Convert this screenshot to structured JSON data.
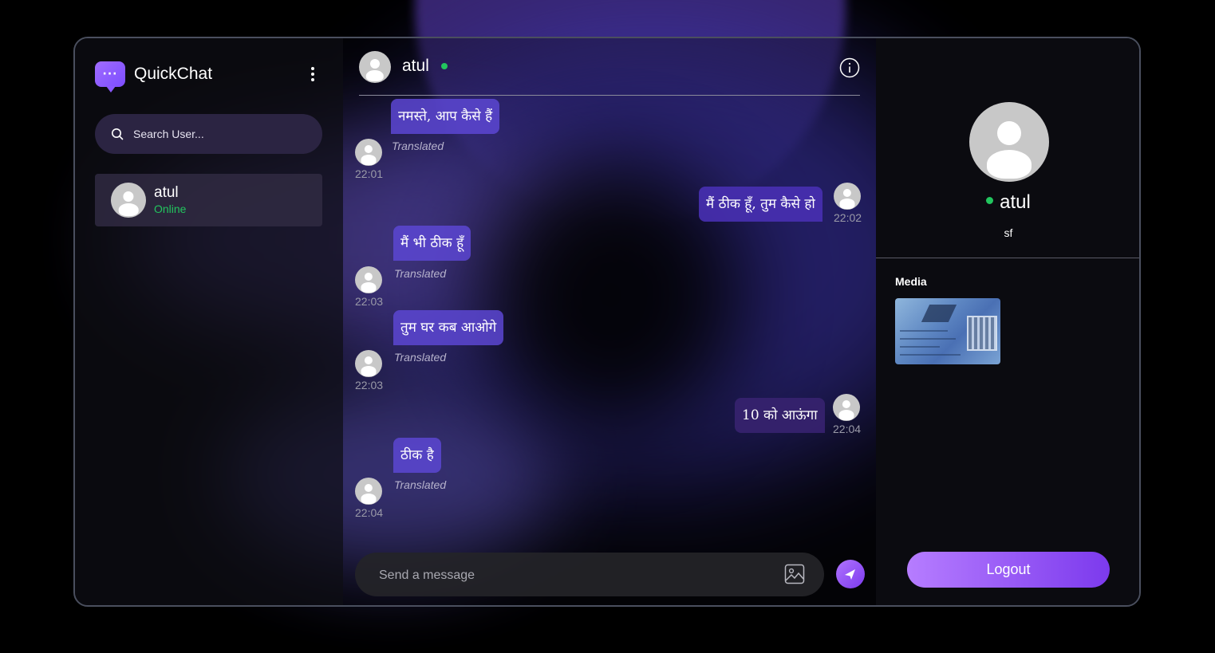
{
  "app": {
    "name": "QuickChat",
    "logo_glyph": "···"
  },
  "sidebar": {
    "search_placeholder": "Search User...",
    "users": [
      {
        "name": "atul",
        "status": "Online"
      }
    ]
  },
  "chat": {
    "contact_name": "atul",
    "messages": [
      {
        "direction": "in",
        "text": "नमस्ते, आप कैसे हैं",
        "translated_label": "Translated",
        "time": "22:01"
      },
      {
        "direction": "out",
        "text": "मैं ठीक हूँ, तुम कैसे हो",
        "time": "22:02"
      },
      {
        "direction": "in",
        "text": "मैं भी ठीक हूँ",
        "translated_label": "Translated",
        "time": "22:03"
      },
      {
        "direction": "in",
        "text": "तुम घर कब आओगे",
        "translated_label": "Translated",
        "time": "22:03"
      },
      {
        "direction": "out",
        "text": "10 को आऊंगा",
        "time": "22:04"
      },
      {
        "direction": "in",
        "text": "ठीक है",
        "translated_label": "Translated",
        "time": "22:04"
      }
    ],
    "composer_placeholder": "Send a message"
  },
  "profile": {
    "name": "atul",
    "bio": "sf",
    "media_label": "Media",
    "logout_label": "Logout"
  },
  "colors": {
    "accent": "#8b5cf6",
    "online": "#22c55e",
    "search_bg": "#2b2442",
    "profile_bg": "#0b0b10"
  }
}
